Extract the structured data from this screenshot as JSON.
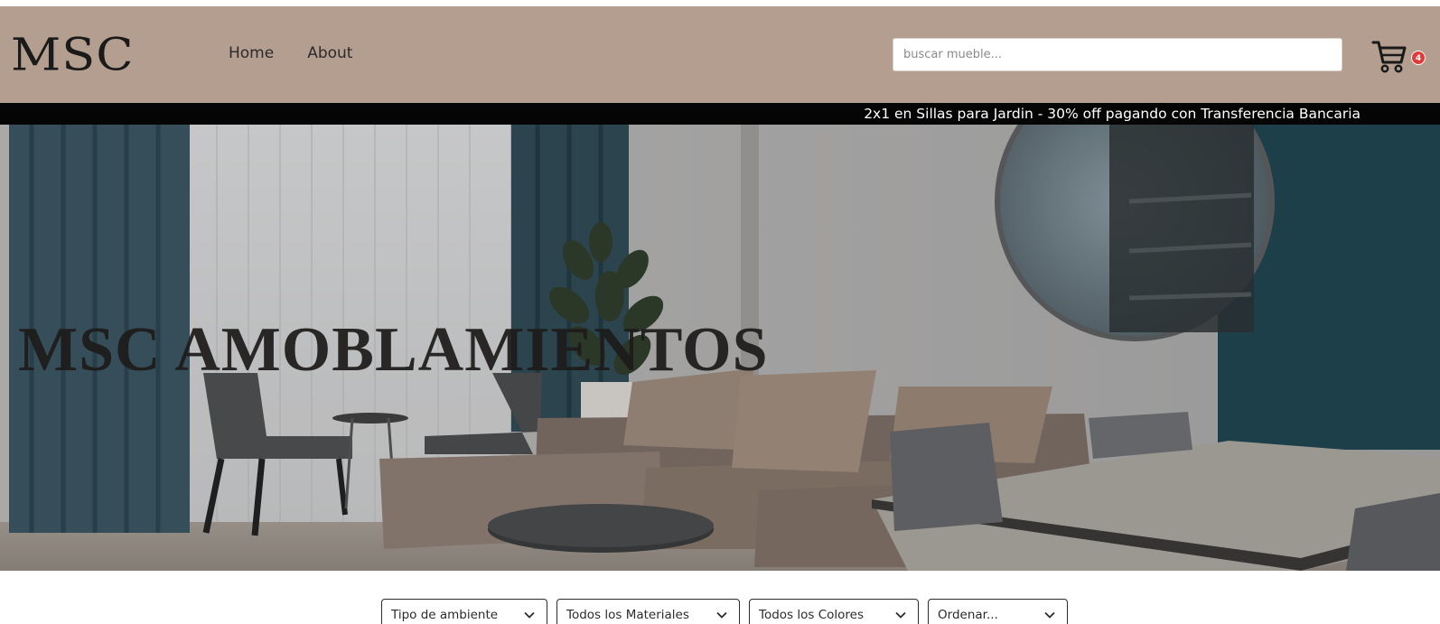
{
  "header": {
    "logo": "MSC",
    "nav": [
      "Home",
      "About"
    ],
    "search_placeholder": "buscar mueble...",
    "cart_count": "4"
  },
  "promo": {
    "text": "2x1 en Sillas para Jardin - 30% off pagando con Transferencia Bancaria"
  },
  "hero": {
    "title": "MSC AMOBLAMIENTOS"
  },
  "filters": [
    {
      "label": "Tipo de ambiente"
    },
    {
      "label": "Todos los Materiales"
    },
    {
      "label": "Todos los Colores"
    },
    {
      "label": "Ordenar..."
    }
  ],
  "colors": {
    "navbar": "#b39e8f",
    "promo_bar": "#050505",
    "badge": "#e23b3b",
    "accent_wall": "#1f4550"
  },
  "icons": [
    "shopping-cart-icon",
    "chevron-down-icon"
  ]
}
